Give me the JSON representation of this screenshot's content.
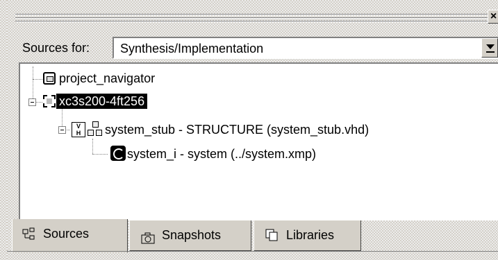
{
  "panel": {
    "close_glyph": "×",
    "sources_for_label": "Sources for:",
    "sources_for_value": "Synthesis/Implementation"
  },
  "tree": {
    "items": [
      {
        "label": "project_navigator",
        "icon": "project-icon",
        "level": 0
      },
      {
        "label": "xc3s200-4ft256",
        "icon": "chip-icon",
        "level": 0,
        "selected": true
      },
      {
        "label": "system_stub - STRUCTURE (system_stub.vhd)",
        "icon": "vhdl-module-icon",
        "level": 1
      },
      {
        "label": "system_i - system (../system.xmp)",
        "icon": "xps-system-icon",
        "level": 2
      }
    ]
  },
  "tabs": [
    {
      "label": "Sources",
      "icon": "sources-tab-icon",
      "active": true
    },
    {
      "label": "Snapshots",
      "icon": "camera-icon",
      "active": false
    },
    {
      "label": "Libraries",
      "icon": "libraries-icon",
      "active": false
    }
  ],
  "colors": {
    "chrome": "#d4d0c8",
    "selection": "#000000",
    "selection_text": "#ffffff"
  }
}
